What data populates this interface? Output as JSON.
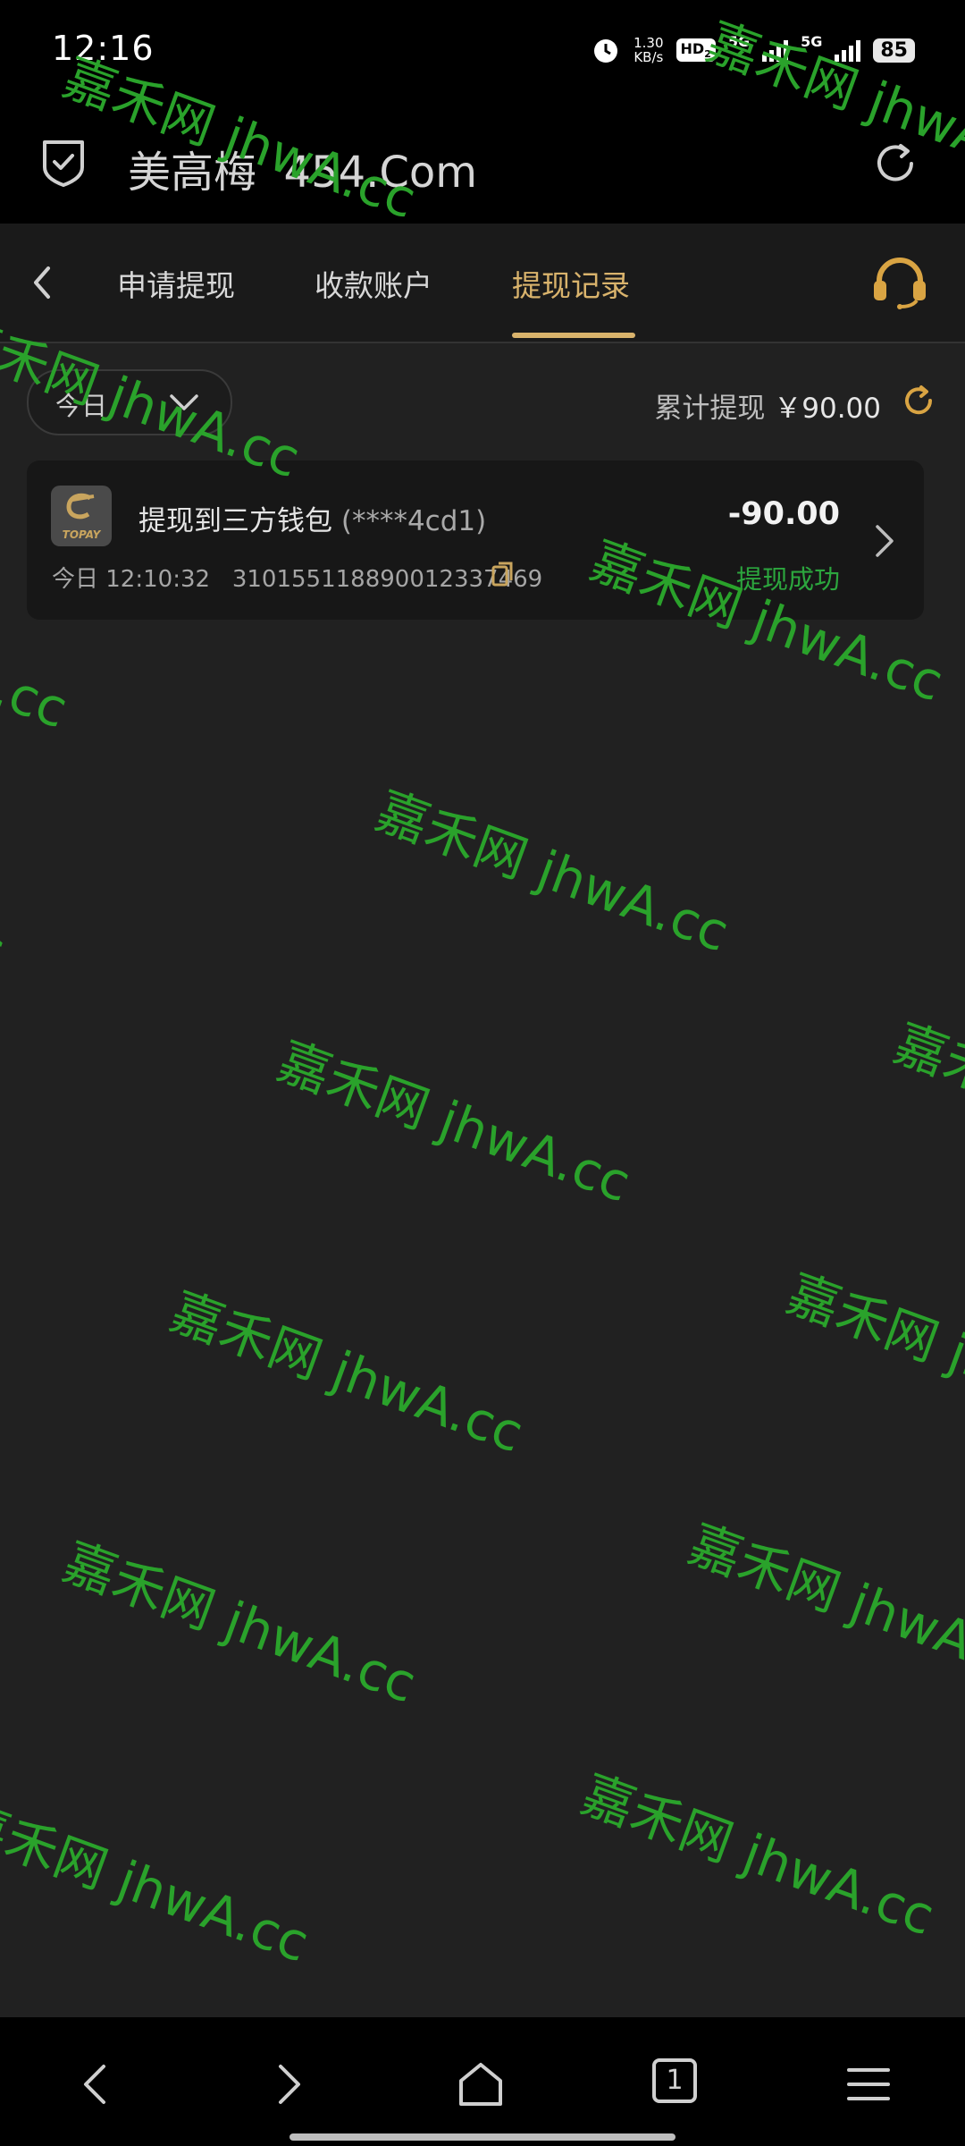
{
  "status_bar": {
    "time": "12:16",
    "speed_value": "1.30",
    "speed_unit": "KB/s",
    "hd_label": "HD",
    "hd_sub": "2",
    "net1": "5G",
    "net2": "5G",
    "battery": "85",
    "alarm_icon": "alarm-icon"
  },
  "browser": {
    "site_name": "美高梅",
    "domain": "454.Com",
    "shield_icon": "shield-check-icon",
    "refresh_icon": "refresh-icon"
  },
  "tabs": [
    {
      "label": "申请提现",
      "active": false
    },
    {
      "label": "收款账户",
      "active": false
    },
    {
      "label": "提现记录",
      "active": true
    }
  ],
  "filter": {
    "period": "今日",
    "total_label": "累计提现",
    "total_amount": "￥90.00"
  },
  "records": [
    {
      "logo_text": "TOPAY",
      "title": "提现到三方钱包",
      "account": "(****4cd1)",
      "amount": "-90.00",
      "date": "今日 12:10:32",
      "order_no": "310155118890012337469",
      "status": "提现成功"
    }
  ],
  "watermark": "嘉禾网 jhwA.cc",
  "bottom_nav": {
    "tab_count": "1"
  },
  "colors": {
    "accent_gold": "#d9b36c",
    "success_green": "#2ca63e",
    "watermark_green": "#2aa22b",
    "background": "#212121"
  }
}
